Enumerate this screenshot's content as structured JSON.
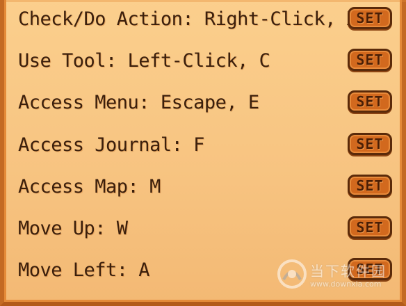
{
  "controls": [
    {
      "label": "Check/Do Action: Right-Click, X",
      "button": "SET"
    },
    {
      "label": "Use Tool: Left-Click, C",
      "button": "SET"
    },
    {
      "label": "Access Menu: Escape, E",
      "button": "SET"
    },
    {
      "label": "Access Journal: F",
      "button": "SET"
    },
    {
      "label": "Access Map: M",
      "button": "SET"
    },
    {
      "label": "Move Up: W",
      "button": "SET"
    },
    {
      "label": "Move Left: A",
      "button": "SET"
    }
  ],
  "watermark": {
    "text": "当下软件园",
    "url": "www.downxia.com"
  },
  "colors": {
    "panel": "#f7c380",
    "border": "#c46a23",
    "button": "#d2691e",
    "text": "#3b1f0c"
  }
}
